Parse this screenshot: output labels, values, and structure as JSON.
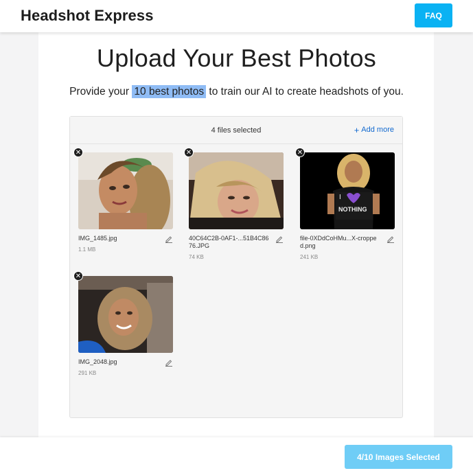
{
  "header": {
    "brand": "Headshot Express",
    "faq_label": "FAQ"
  },
  "main": {
    "title": "Upload Your Best Photos",
    "subtitle_before": "Provide your ",
    "subtitle_highlight": "10 best photos",
    "subtitle_after": " to train our AI to create headshots of you."
  },
  "uploader": {
    "files_selected": "4 files selected",
    "add_more_label": "Add more",
    "files": [
      {
        "name": "IMG_1485.jpg",
        "size": "1.1 MB"
      },
      {
        "name": "40C64C2B-0AF1-...51B4C8676.JPG",
        "size": "74 KB"
      },
      {
        "name": "file-0XDdCoHMu...X-cropped.png",
        "size": "241 KB"
      },
      {
        "name": "IMG_2048.jpg",
        "size": "291 KB"
      }
    ]
  },
  "footer": {
    "selected_label": "4/10 Images Selected"
  },
  "colors": {
    "accent": "#0ab2f3",
    "accent_disabled": "#6fcdf6",
    "link": "#1269cf",
    "highlight": "#8fbcf5"
  },
  "icons": [
    "close-icon",
    "plus-icon",
    "pencil-icon"
  ]
}
